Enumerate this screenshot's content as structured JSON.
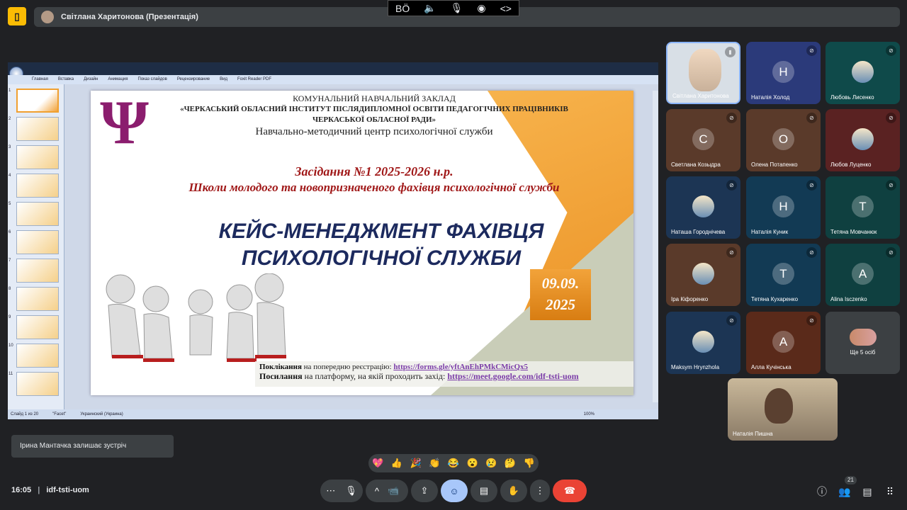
{
  "meeting": {
    "code": "idf-tsti-uom",
    "time": "16:05"
  },
  "presenter_bar": {
    "label": "Світлана Харитонова (Презентація)"
  },
  "accessibility": [
    "BÖ",
    "🔈",
    "🎙",
    "◉",
    "<>"
  ],
  "ppt": {
    "menu": [
      "Главная",
      "Вставка",
      "Дизайн",
      "Анимация",
      "Показ слайдов",
      "Рецензирование",
      "Вид",
      "Foxit Reader PDF"
    ],
    "status": {
      "slide": "Слайд 1 из 20",
      "theme": "\"Facet\"",
      "lang": "Украинский (Украина)",
      "zoom": "100%"
    },
    "thumb_numbers": [
      "1",
      "2",
      "3",
      "4",
      "5",
      "6",
      "7",
      "8",
      "9",
      "10",
      "11"
    ]
  },
  "slide": {
    "line1": "КОМУНАЛЬНИЙ НАВЧАЛЬНИЙ ЗАКЛАД",
    "line2": "«ЧЕРКАСЬКИЙ ОБЛАСНИЙ ІНСТИТУТ ПІСЛЯДИПЛОМНОЇ ОСВІТИ ПЕДАГОГІЧНИХ ПРАЦІВНИКІВ",
    "line3": "ЧЕРКАСЬКОЇ ОБЛАСНОЇ РАДИ»",
    "line4": "Навчально-методичний центр психологічної служби",
    "session": "Засідання №1 2025-2026 н.р.",
    "school": "Школи молодого та новопризначеного фахівця психологічної служби",
    "title1": "КЕЙС-МЕНЕДЖМЕНТ ФАХІВЦЯ",
    "title2": "ПСИХОЛОГІЧНОЇ СЛУЖБИ",
    "date1": "09.09.",
    "date2": "2025",
    "psi": "Ψ",
    "link1_label": "Поклікання",
    "link1_text": " на попередню реєстрацію: ",
    "link1_url": "https://forms.gle/yftAnEhPMkCMicQx5",
    "link2_label": "Посилання",
    "link2_text": " на платформу, на якій проходить захід: ",
    "link2_url": "https://meet.google.com/idf-tsti-uom"
  },
  "participants": [
    {
      "name": "Світлана Харитонова",
      "letter": "",
      "color": "#d8dfe6"
    },
    {
      "name": "Наталія Холод",
      "letter": "Н",
      "color": "#2b3a7a"
    },
    {
      "name": "Любовь Лисенко",
      "letter": "",
      "color": "#0f4a4a"
    },
    {
      "name": "Светлана Козыдра",
      "letter": "С",
      "color": "#5a3a2a"
    },
    {
      "name": "Олена Потапенко",
      "letter": "О",
      "color": "#5a3a2a"
    },
    {
      "name": "Любов Луценко",
      "letter": "",
      "color": "#5a2222"
    },
    {
      "name": "Наташа Городнічева",
      "letter": "",
      "color": "#1c3554"
    },
    {
      "name": "Наталія Куник",
      "letter": "Н",
      "color": "#123a54"
    },
    {
      "name": "Тетяна Мовчанюк",
      "letter": "Т",
      "color": "#0f4040"
    },
    {
      "name": "Іра Кіфоренко",
      "letter": "",
      "color": "#5a3a2a"
    },
    {
      "name": "Тетяна Кухаренко",
      "letter": "Т",
      "color": "#123a54"
    },
    {
      "name": "Alina Isczenko",
      "letter": "A",
      "color": "#0f4040"
    },
    {
      "name": "Maksym Hrynzhola",
      "letter": "",
      "color": "#1c3554"
    },
    {
      "name": "Алла Кучінська",
      "letter": "A",
      "color": "#5a2a1a"
    },
    {
      "name": "Ще 5 осіб",
      "letter": "",
      "color": "#3c4043"
    }
  ],
  "self_view": {
    "name": "Наталія Пишна"
  },
  "toast": "Ірина Мантачка залишає зустріч",
  "reactions": [
    "💖",
    "👍",
    "🎉",
    "👏",
    "😂",
    "😮",
    "😢",
    "🤔",
    "👎"
  ],
  "people_count": "21"
}
